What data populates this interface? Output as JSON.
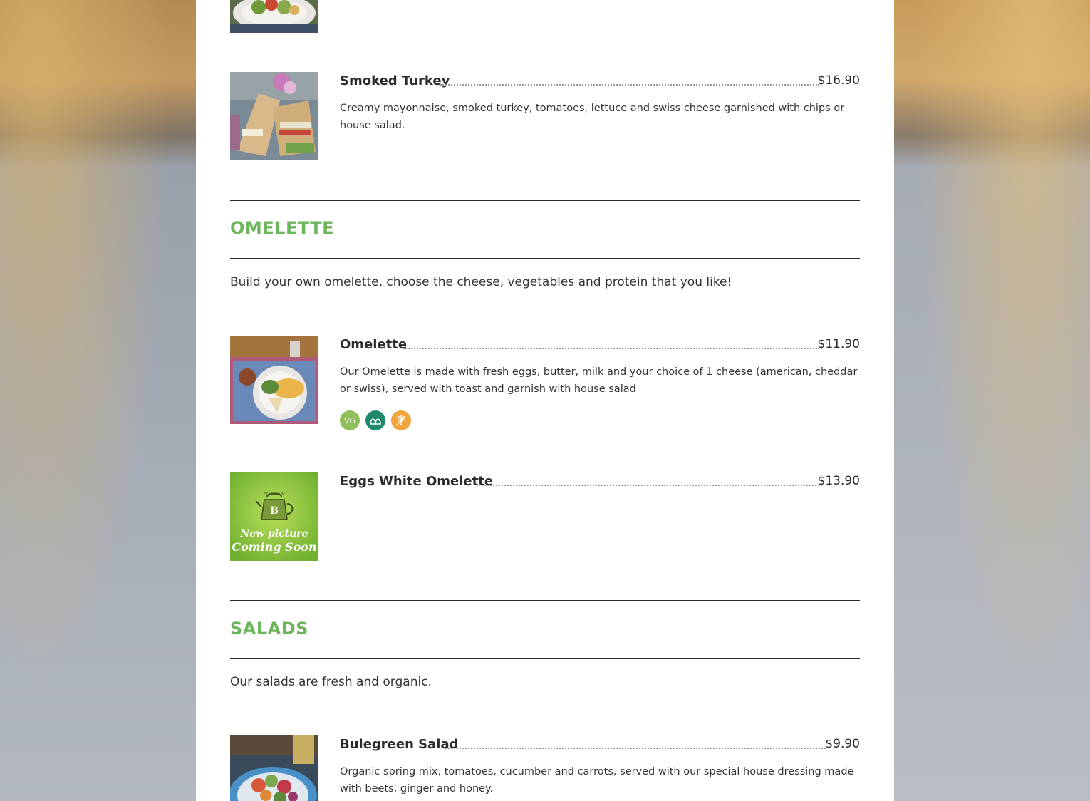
{
  "colors": {
    "accent_green": "#6bb55a",
    "badge_vegetarian": "#8fbf5a",
    "badge_vegan": "#1f8a6b",
    "badge_gluten_free": "#f0a63c"
  },
  "menu": {
    "items_top": [
      {
        "title": "Smoked Turkey",
        "price": "$16.90",
        "description": "Creamy mayonnaise, smoked turkey, tomatoes, lettuce and swiss cheese garnished with chips or house salad."
      }
    ],
    "omelette": {
      "heading": "OMELETTE",
      "description": "Build your own omelette, choose the cheese, vegetables and protein that you like!",
      "items": [
        {
          "title": "Omelette",
          "price": "$11.90",
          "description": "Our Omelette is made with fresh eggs, butter, milk and your choice of 1 cheese (american, cheddar or swiss), served with toast and garnish with house salad",
          "badges": [
            {
              "label": "VG",
              "icon": "vegetarian-icon"
            },
            {
              "label": "",
              "icon": "vegan-leaf-icon"
            },
            {
              "label": "",
              "icon": "gluten-free-icon"
            }
          ]
        },
        {
          "title": "Eggs White Omelette",
          "price": "$13.90",
          "image_text": {
            "brand_top": "FEEL GOOD",
            "brand_letter": "B",
            "line1": "New picture",
            "line2": "Coming Soon"
          }
        }
      ]
    },
    "salads": {
      "heading": "SALADS",
      "description": "Our salads are fresh and organic.",
      "items": [
        {
          "title": "Bulegreen Salad",
          "price": "$9.90",
          "description": "Organic spring mix, tomatoes, cucumber and carrots, served with our special house dressing made with beets, ginger and honey."
        }
      ]
    }
  }
}
